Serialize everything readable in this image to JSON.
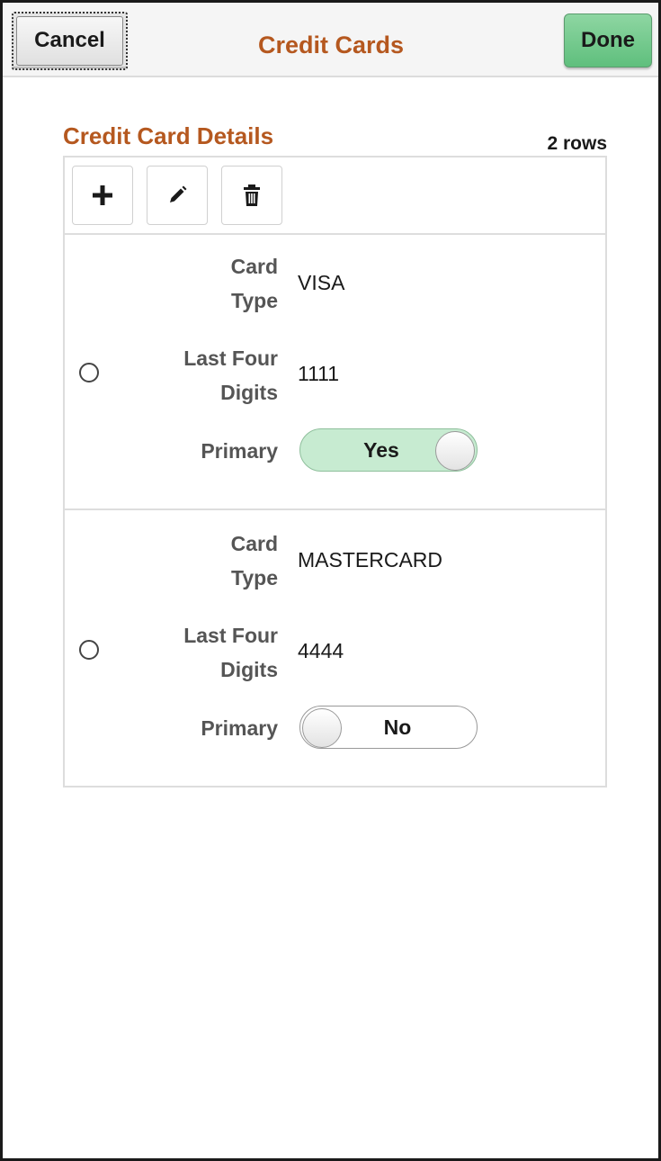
{
  "header": {
    "cancel_label": "Cancel",
    "title": "Credit Cards",
    "done_label": "Done"
  },
  "section": {
    "title": "Credit Card Details",
    "row_count": "2 rows"
  },
  "toolbar": {
    "buttons": [
      {
        "icon": "plus-icon"
      },
      {
        "icon": "pencil-icon"
      },
      {
        "icon": "trash-icon"
      }
    ]
  },
  "labels": {
    "card_type_line1": "Card",
    "card_type_line2": "Type",
    "last_four_line1": "Last Four",
    "last_four_line2": "Digits",
    "primary": "Primary"
  },
  "rows": [
    {
      "card_type": "VISA",
      "last_four": "1111",
      "primary": "Yes",
      "primary_on": true,
      "selected": false
    },
    {
      "card_type": "MASTERCARD",
      "last_four": "4444",
      "primary": "No",
      "primary_on": false,
      "selected": false
    }
  ],
  "colors": {
    "accent_title": "#b5581f",
    "done_button": "#6cc68a",
    "toggle_on": "#c7ebd1"
  }
}
